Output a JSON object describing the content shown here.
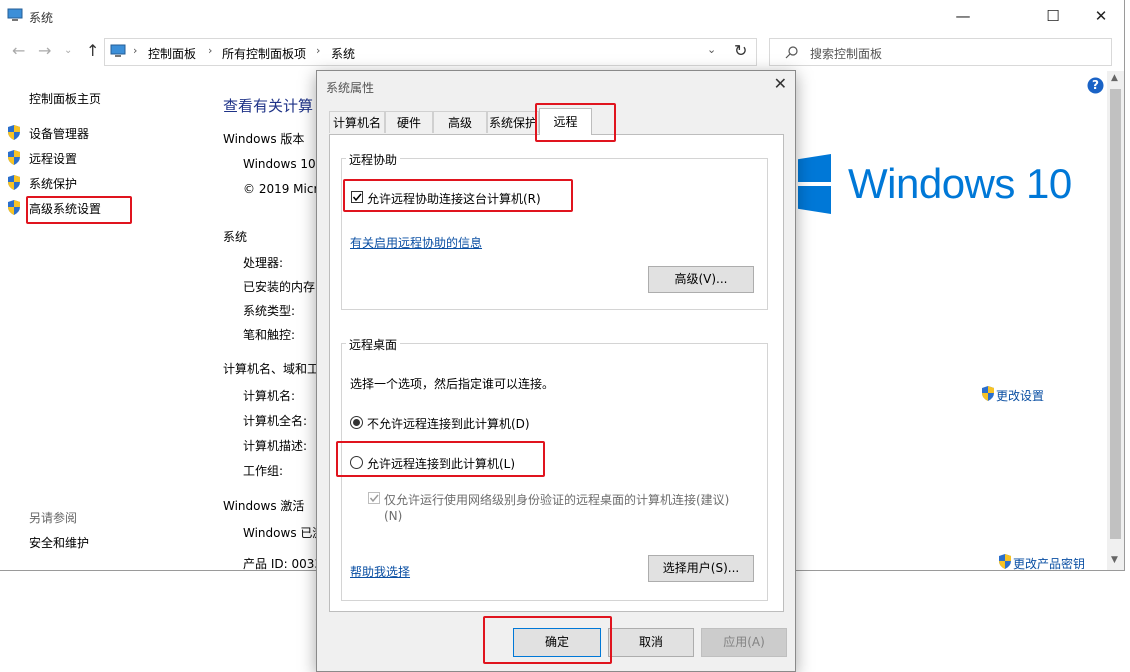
{
  "window": {
    "title": "系统",
    "minimize": "—",
    "maximize": "☐",
    "close": "✕"
  },
  "addressbar": {
    "crumbs": [
      "控制面板",
      "所有控制面板项",
      "系统"
    ],
    "search_placeholder": "搜索控制面板"
  },
  "sidebar": {
    "home": "控制面板主页",
    "items": [
      "设备管理器",
      "远程设置",
      "系统保护",
      "高级系统设置"
    ],
    "see_also_title": "另请参阅",
    "see_also": [
      "安全和维护"
    ]
  },
  "main": {
    "heading": "查看有关计算",
    "windows_edition_title": "Windows 版本",
    "edition_line": "Windows 10",
    "copyright_line": "© 2019 Micr",
    "system_title": "系统",
    "system_rows": [
      "处理器:",
      "已安装的内存",
      "系统类型:",
      "笔和触控:"
    ],
    "computer_title": "计算机名、域和工",
    "computer_rows": [
      "计算机名:",
      "计算机全名:",
      "计算机描述:",
      "工作组:"
    ],
    "activation_title": "Windows 激活",
    "activation_line": "Windows 已激",
    "product_id": "产品 ID: 0033",
    "logo_text": "Windows 10",
    "change_settings": "更改设置",
    "change_product_key": "更改产品密钥",
    "help_icon": "?"
  },
  "dialog": {
    "title": "系统属性",
    "close": "✕",
    "tabs": [
      "计算机名",
      "硬件",
      "高级",
      "系统保护",
      "远程"
    ],
    "active_tab": "远程",
    "remote_assistance": {
      "group_label": "远程协助",
      "checkbox_label": "允许远程协助连接这台计算机(R)",
      "checkbox_checked": true,
      "info_link": "有关启用远程协助的信息",
      "advanced_button": "高级(V)..."
    },
    "remote_desktop": {
      "group_label": "远程桌面",
      "instruction": "选择一个选项，然后指定谁可以连接。",
      "option_deny": "不允许远程连接到此计算机(D)",
      "option_allow": "允许远程连接到此计算机(L)",
      "selected": "option_deny",
      "nla_label_line1": "仅允许运行使用网络级别身份验证的远程桌面的计算机连接(建议)",
      "nla_label_line2": "(N)",
      "help_link": "帮助我选择",
      "select_users_button": "选择用户(S)..."
    },
    "ok": "确定",
    "cancel": "取消",
    "apply": "应用(A)"
  },
  "colors": {
    "highlight_red": "#e0141e",
    "link_blue": "#0a4fa3",
    "windows_blue": "#0078d7"
  }
}
